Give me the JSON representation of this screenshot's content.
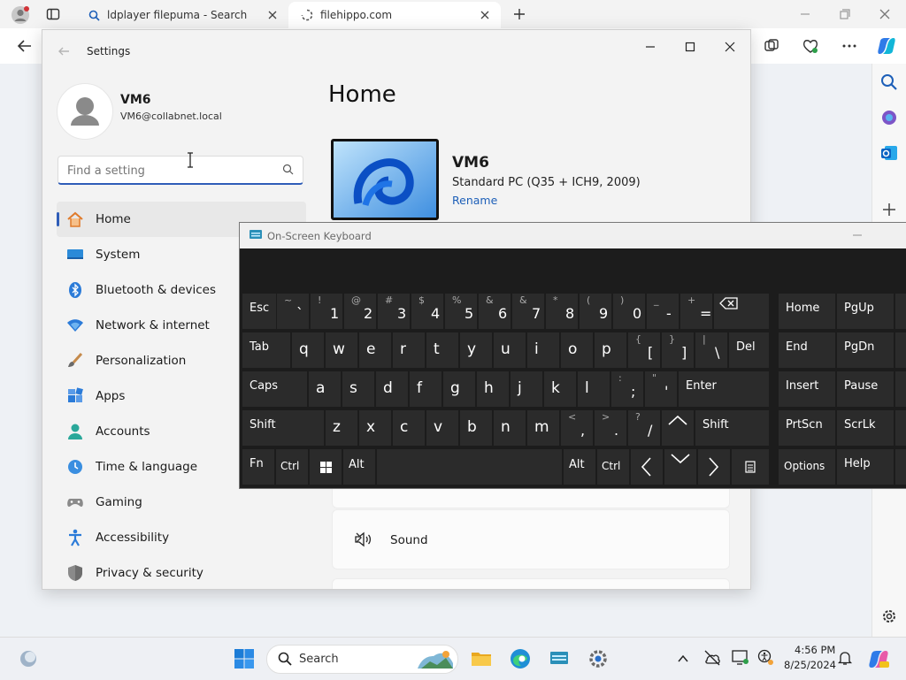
{
  "browser": {
    "tabs": [
      {
        "title": "ldplayer filepuma - Search"
      },
      {
        "title": "filehippo.com"
      }
    ]
  },
  "settings": {
    "window_title": "Settings",
    "profile": {
      "name": "VM6",
      "email": "VM6@collabnet.local"
    },
    "search_placeholder": "Find a setting",
    "nav": [
      {
        "label": "Home",
        "icon": "home-icon"
      },
      {
        "label": "System",
        "icon": "system-icon"
      },
      {
        "label": "Bluetooth & devices",
        "icon": "bluetooth-icon"
      },
      {
        "label": "Network & internet",
        "icon": "wifi-icon"
      },
      {
        "label": "Personalization",
        "icon": "brush-icon"
      },
      {
        "label": "Apps",
        "icon": "apps-icon"
      },
      {
        "label": "Accounts",
        "icon": "person-icon"
      },
      {
        "label": "Time & language",
        "icon": "clock-globe-icon"
      },
      {
        "label": "Gaming",
        "icon": "gamepad-icon"
      },
      {
        "label": "Accessibility",
        "icon": "accessibility-icon"
      },
      {
        "label": "Privacy & security",
        "icon": "shield-icon"
      }
    ],
    "home": {
      "title": "Home",
      "device_name": "VM6",
      "device_model": "Standard PC (Q35 + ICH9, 2009)",
      "rename_label": "Rename",
      "sound_label": "Sound"
    }
  },
  "osk": {
    "title": "On-Screen Keyboard",
    "keys": {
      "esc": "Esc",
      "n1": {
        "top": "!",
        "bottom": "1"
      },
      "n2": {
        "top": "@",
        "bottom": "2"
      },
      "n3": {
        "top": "#",
        "bottom": "3"
      },
      "n4": {
        "top": "$",
        "bottom": "4"
      },
      "n5": {
        "top": "%",
        "bottom": "5"
      },
      "n6": {
        "top": "&",
        "bottom": "6"
      },
      "n7": {
        "top": "&",
        "bottom": "7"
      },
      "n8": {
        "top": "*",
        "bottom": "8"
      },
      "n9": {
        "top": "(",
        "bottom": "9"
      },
      "n0": {
        "top": ")",
        "bottom": "0"
      },
      "backtick": {
        "top": "~",
        "bottom": "`"
      },
      "minus": {
        "top": "_",
        "bottom": "-"
      },
      "equals": {
        "top": "+",
        "bottom": "="
      },
      "tab": "Tab",
      "q": "q",
      "w": "w",
      "e": "e",
      "r": "r",
      "t": "t",
      "y": "y",
      "u": "u",
      "i": "i",
      "o": "o",
      "p": "p",
      "lbracket": {
        "top": "{",
        "bottom": "["
      },
      "rbracket": {
        "top": "}",
        "bottom": "]"
      },
      "backslash": {
        "top": "|",
        "bottom": "\\"
      },
      "del": "Del",
      "caps": "Caps",
      "a": "a",
      "s": "s",
      "d": "d",
      "f": "f",
      "g": "g",
      "h": "h",
      "j": "j",
      "k": "k",
      "l": "l",
      "semicolon": {
        "top": ":",
        "bottom": ";"
      },
      "quote": {
        "top": "\"",
        "bottom": "'"
      },
      "enter": "Enter",
      "shift": "Shift",
      "z": "z",
      "x": "x",
      "c": "c",
      "v": "v",
      "b": "b",
      "n": "n",
      "m": "m",
      "comma": {
        "top": "<",
        "bottom": ","
      },
      "period": {
        "top": ">",
        "bottom": "."
      },
      "slash": {
        "top": "?",
        "bottom": "/"
      },
      "fn": "Fn",
      "ctrl": "Ctrl",
      "alt": "Alt",
      "home": "Home",
      "pgup": "PgUp",
      "end": "End",
      "pgdn": "PgDn",
      "insert": "Insert",
      "pause": "Pause",
      "prtscn": "PrtScn",
      "scrlk": "ScrLk",
      "options": "Options",
      "help": "Help"
    }
  },
  "taskbar": {
    "search_label": "Search",
    "time": "4:56 PM",
    "date": "8/25/2024"
  },
  "colors": {
    "accent": "#2f5db8",
    "link": "#1d5fb8",
    "osk_key": "#2b2b2b",
    "osk_bg": "#1c1c1c"
  }
}
